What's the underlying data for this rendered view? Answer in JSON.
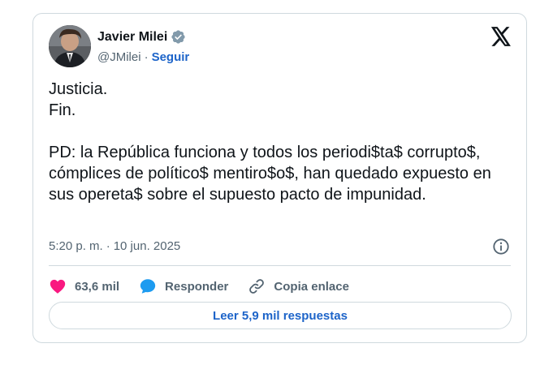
{
  "author": {
    "name": "Javier Milei",
    "handle": "@JMilei",
    "separator": "·",
    "follow_label": "Seguir"
  },
  "tweet": {
    "text": "Justicia.\nFin.\n\nPD: la República funciona y todos los periodi$ta$ corrupto$, cómplices de político$ mentiro$o$, han quedado expuesto en sus opereta$ sobre el supuesto pacto de impunidad.",
    "time": "5:20 p. m.",
    "date_separator": "·",
    "date": "10 jun. 2025"
  },
  "actions": {
    "likes": "63,6 mil",
    "reply_label": "Responder",
    "copy_link_label": "Copia enlace"
  },
  "read_replies_label": "Leer 5,9 mil respuestas",
  "colors": {
    "accent": "#1d64c9",
    "like": "#f91880",
    "reply_bubble": "#1d9bf0",
    "verified": "#829aab",
    "border": "#cfd9de",
    "muted": "#536471"
  },
  "icons": {
    "verified": "verified-badge-icon",
    "x_logo": "x-logo-icon",
    "info": "info-icon",
    "like": "heart-icon",
    "reply": "speech-bubble-icon",
    "copy_link": "link-icon"
  }
}
